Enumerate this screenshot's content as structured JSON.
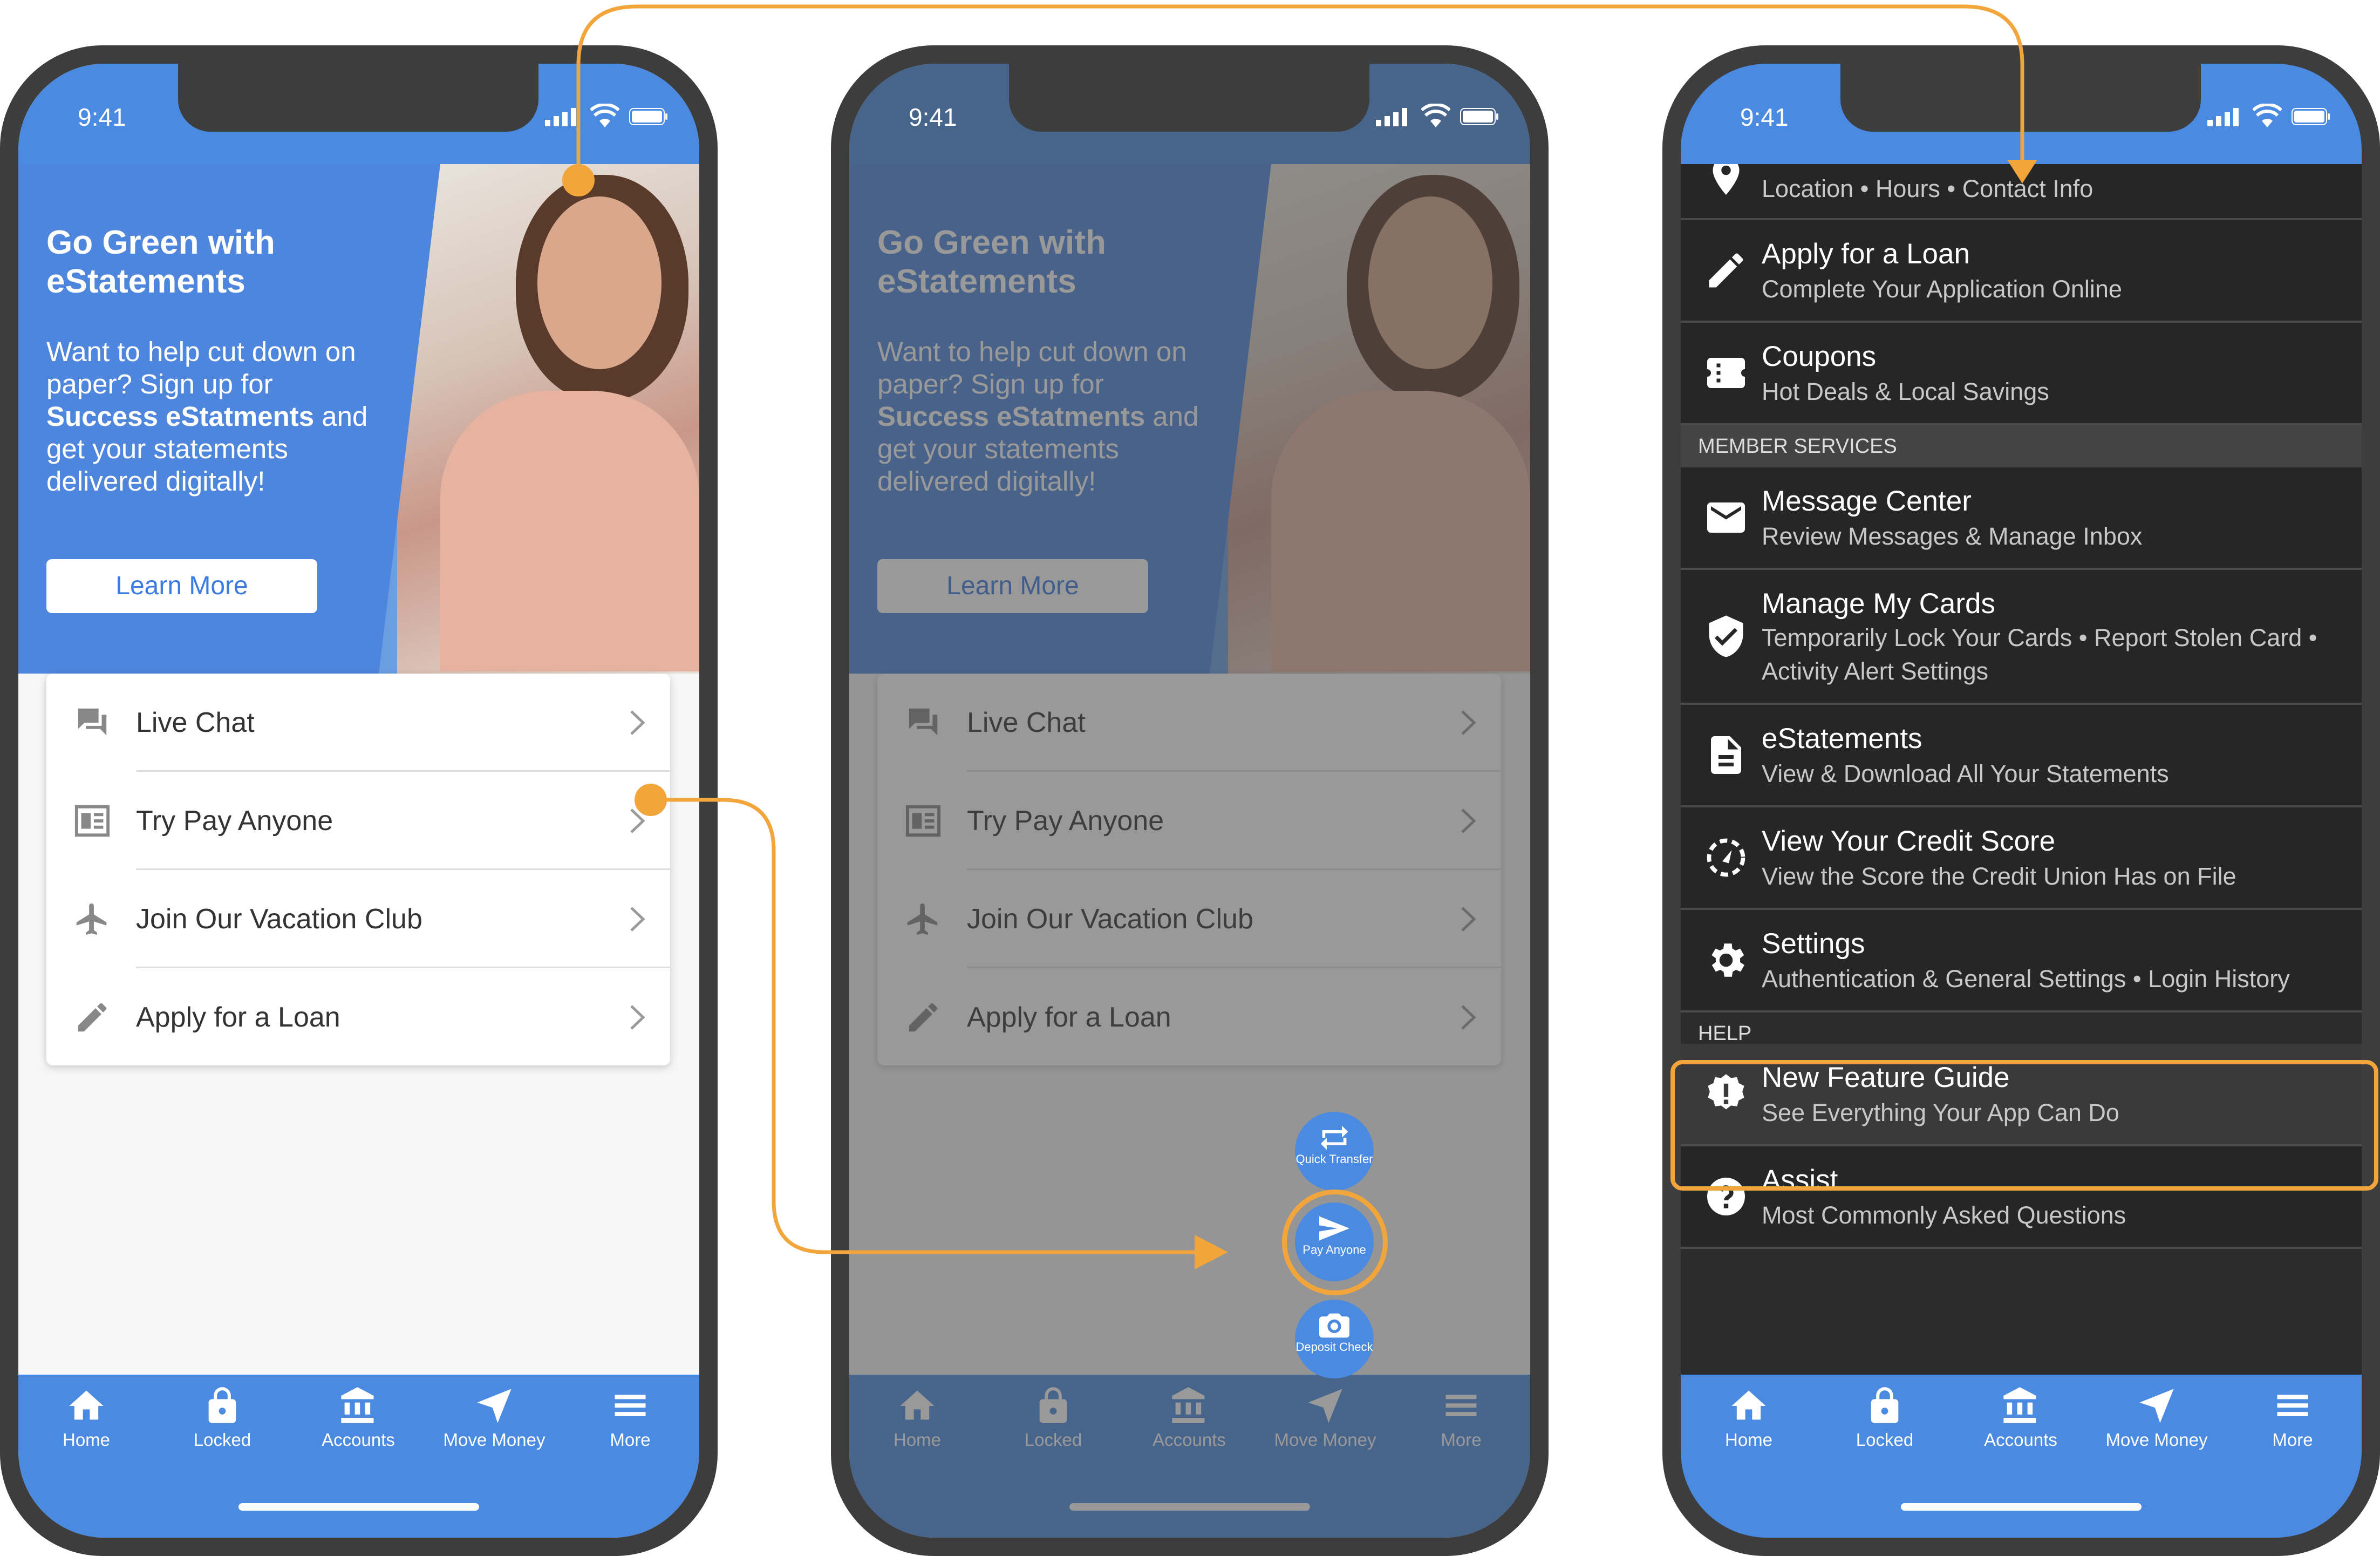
{
  "status": {
    "time": "9:41"
  },
  "hero": {
    "title": "Go Green with eStatements",
    "text_pre": "Want to help cut down on paper? Sign up for",
    "text_bold": "Success eStatments",
    "text_post": "and get your statements delivered digitally!",
    "button": "Learn More"
  },
  "list": [
    {
      "label": "Live Chat",
      "icon": "chat-icon"
    },
    {
      "label": "Try Pay Anyone",
      "icon": "pay-anyone-icon"
    },
    {
      "label": "Join Our Vacation Club",
      "icon": "airplane-icon"
    },
    {
      "label": "Apply for a Loan",
      "icon": "pencil-icon"
    }
  ],
  "tabs": [
    {
      "label": "Home",
      "icon": "home-icon"
    },
    {
      "label": "Locked",
      "icon": "lock-icon"
    },
    {
      "label": "Accounts",
      "icon": "bank-icon"
    },
    {
      "label": "Move Money",
      "icon": "send-icon"
    },
    {
      "label": "More",
      "icon": "menu-icon"
    }
  ],
  "fabs": [
    {
      "label": "Quick Transfer",
      "icon": "transfer-icon"
    },
    {
      "label": "Pay Anyone",
      "icon": "send-icon"
    },
    {
      "label": "Deposit Check",
      "icon": "camera-icon"
    }
  ],
  "menu": {
    "partial_subtitle": "Location • Hours • Contact Info",
    "items_top": [
      {
        "title": "Apply for a Loan",
        "subtitle": "Complete Your Application Online",
        "icon": "pencil-icon"
      },
      {
        "title": "Coupons",
        "subtitle": "Hot Deals & Local Savings",
        "icon": "ticket-icon"
      }
    ],
    "section_member": "MEMBER SERVICES",
    "items_member": [
      {
        "title": "Message Center",
        "subtitle": "Review Messages & Manage Inbox",
        "icon": "mail-icon"
      },
      {
        "title": "Manage My Cards",
        "subtitle": "Temporarily Lock Your Cards • Report Stolen Card •",
        "subtitle2": "Activity Alert Settings",
        "icon": "shield-check-icon"
      },
      {
        "title": "eStatements",
        "subtitle": "View & Download All Your Statements",
        "icon": "document-icon"
      },
      {
        "title": "View Your Credit Score",
        "subtitle": "View the Score the Credit Union Has on File",
        "icon": "gauge-icon"
      },
      {
        "title": "Settings",
        "subtitle": "Authentication & General Settings • Login History",
        "icon": "gear-icon"
      }
    ],
    "section_help": "HELP",
    "items_help": [
      {
        "title": "New Feature Guide",
        "subtitle": "See Everything Your App Can Do",
        "icon": "alert-badge-icon"
      },
      {
        "title": "Assist",
        "subtitle": "Most Commonly Asked Questions",
        "icon": "question-icon"
      }
    ]
  },
  "colors": {
    "brand_blue": "#4a8ae0",
    "highlight_orange": "#f2a53a",
    "dark_menu": "#262626"
  }
}
